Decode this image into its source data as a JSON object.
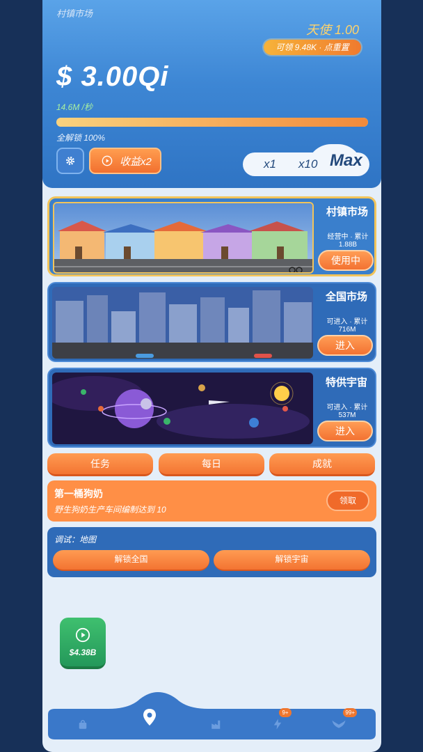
{
  "header": {
    "title": "村镇市场",
    "angel_label": "天使 1.00",
    "reset_pill": "可领 9.48K · 点重置",
    "money": "$ 3.00Qi",
    "rate": "14.6M /秒",
    "progress_fraction": 1.0,
    "unlock_label": "全解锁 100%",
    "earn_button": "收益x2",
    "multipliers": [
      "x1",
      "x10",
      "Max"
    ]
  },
  "markets": [
    {
      "name": "村镇市场",
      "status": "经营中 · 累计 1.88B",
      "button": "使用中",
      "scene": "village-market-scene"
    },
    {
      "name": "全国市场",
      "status": "可进入 · 累计 716M",
      "button": "进入",
      "scene": "city-market-scene"
    },
    {
      "name": "特供宇宙",
      "status": "可进入 · 累计 537M",
      "button": "进入",
      "scene": "space-market-scene"
    }
  ],
  "tabs": [
    "任务",
    "每日",
    "成就"
  ],
  "task": {
    "title": "第一桶狗奶",
    "desc": "野生狗奶生产车间编制达到 10",
    "claim": "领取"
  },
  "debug": {
    "title": "调试：地图",
    "btn_unlock_national": "解锁全国",
    "btn_unlock_universe": "解锁宇宙"
  },
  "ad_button": {
    "value": "$4.38B"
  },
  "nav": {
    "items": [
      {
        "icon": "shopping-bag-icon"
      },
      {
        "icon": "map-pin-icon"
      },
      {
        "icon": "factory-icon"
      },
      {
        "icon": "lightning-icon",
        "badge": "9+"
      },
      {
        "icon": "angel-wings-icon",
        "badge": "99+"
      }
    ]
  },
  "colors": {
    "background": "#173058",
    "header_blue": "#3d86d4",
    "accent_orange": "#f37432",
    "highlight_gold": "#f2c45a",
    "ad_green": "#24985a"
  }
}
